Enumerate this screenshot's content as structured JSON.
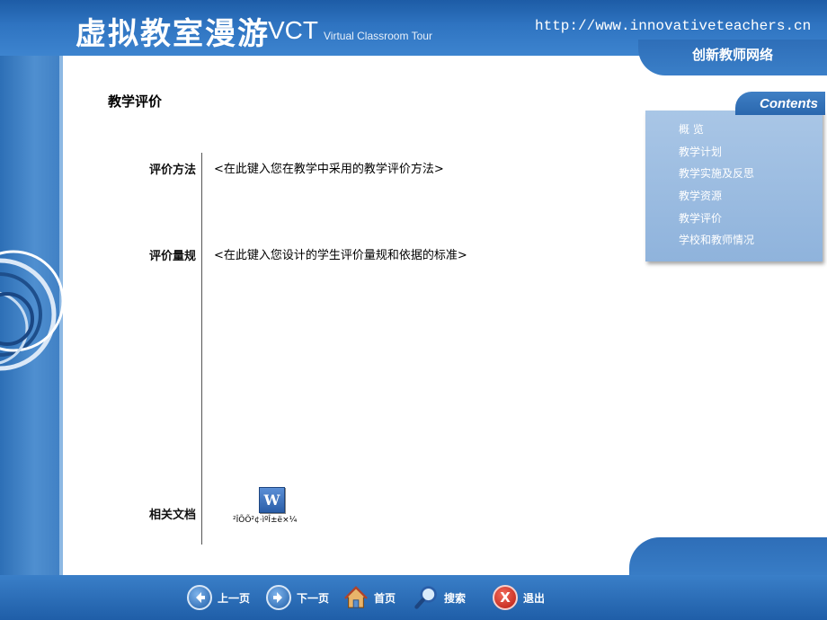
{
  "header": {
    "title_cn": "虚拟教室漫游",
    "title_abbr": "VCT",
    "title_en": "Virtual Classroom Tour",
    "url": "http://www.innovativeteachers.cn",
    "site_name": "创新教师网络"
  },
  "main": {
    "page_title": "教学评价",
    "sections": [
      {
        "label": "评价方法",
        "value": "<在此键入您在教学中采用的教学评价方法>"
      },
      {
        "label": "评价量规",
        "value": "<在此键入您设计的学生评价量规和依据的标准>"
      }
    ],
    "related_docs": {
      "label": "相关文档",
      "icon_letter": "W",
      "doc_caption": "²ÎÕÕ²¢·ìºÎ±ë×¼"
    }
  },
  "contents": {
    "tab_label": "Contents",
    "items": [
      "概  览",
      "教学计划",
      "教学实施及反思",
      "教学资源",
      "教学评价",
      "学校和教师情况"
    ]
  },
  "navbar": {
    "prev_label": "上一页",
    "next_label": "下一页",
    "home_label": "首页",
    "search_label": "搜索",
    "exit_label": "退出",
    "exit_icon_letter": "X"
  },
  "icons": {
    "prev": "arrow-left-icon",
    "next": "arrow-right-icon",
    "home": "house-icon",
    "search": "magnifier-icon",
    "exit": "close-icon",
    "doc": "word-document-icon"
  },
  "colors": {
    "brand_blue": "#2f74c1",
    "panel_blue": "#a9c6e6",
    "exit_red": "#c0281c"
  }
}
